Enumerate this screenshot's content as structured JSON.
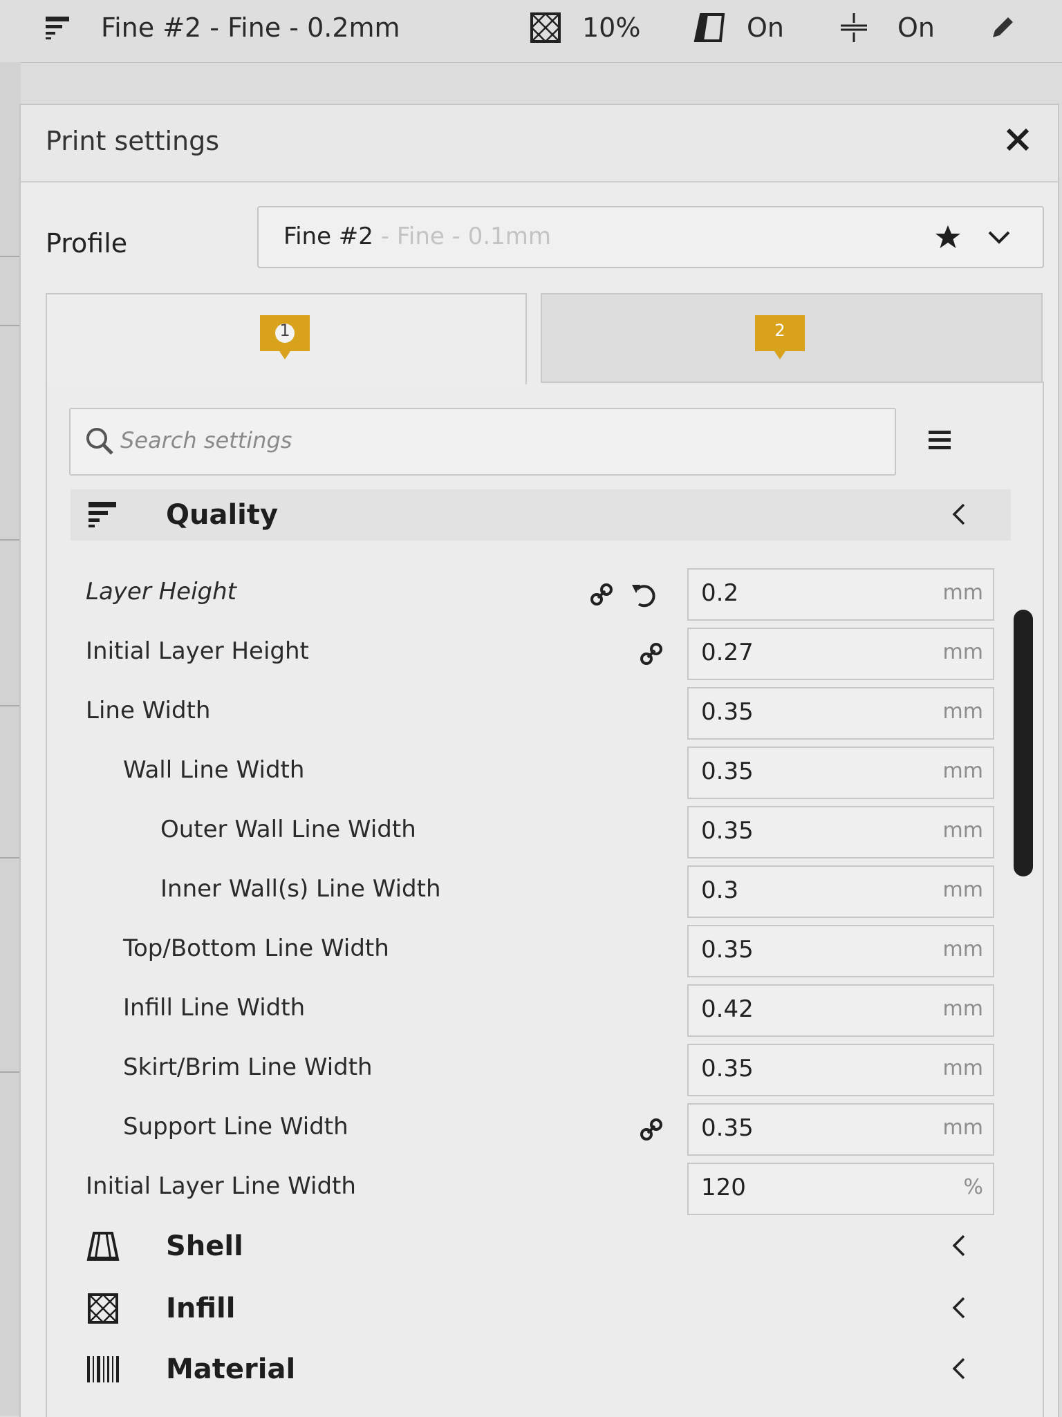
{
  "toolbar": {
    "profile_text": "Fine #2 - Fine - 0.2mm",
    "infill_value": "10%",
    "support_value": "On",
    "adhesion_value": "On"
  },
  "panel": {
    "title": "Print settings",
    "profile_label": "Profile",
    "profile_name": "Fine #2",
    "profile_suffix": " - Fine - 0.1mm",
    "extruder_tabs": [
      "1",
      "2"
    ],
    "search_placeholder": "Search settings"
  },
  "colors": {
    "extruder_badge": "#d9a21c",
    "scrollbar": "#1f1f1f"
  },
  "categories": [
    {
      "label": "Quality",
      "icon": "quality-icon",
      "expanded": true
    },
    {
      "label": "Shell",
      "icon": "shell-icon",
      "expanded": false
    },
    {
      "label": "Infill",
      "icon": "infill-icon",
      "expanded": false
    },
    {
      "label": "Material",
      "icon": "material-icon",
      "expanded": false
    }
  ],
  "settings": [
    {
      "label": "Layer Height",
      "value": "0.2",
      "unit": "mm",
      "linked": true,
      "resettable": true,
      "italic": true
    },
    {
      "label": "Initial Layer Height",
      "value": "0.27",
      "unit": "mm",
      "linked": true
    },
    {
      "label": "Line Width",
      "value": "0.35",
      "unit": "mm"
    },
    {
      "label": "Wall Line Width",
      "value": "0.35",
      "unit": "mm"
    },
    {
      "label": "Outer Wall Line Width",
      "value": "0.35",
      "unit": "mm"
    },
    {
      "label": "Inner Wall(s) Line Width",
      "value": "0.3",
      "unit": "mm"
    },
    {
      "label": "Top/Bottom Line Width",
      "value": "0.35",
      "unit": "mm"
    },
    {
      "label": "Infill Line Width",
      "value": "0.42",
      "unit": "mm"
    },
    {
      "label": "Skirt/Brim Line Width",
      "value": "0.35",
      "unit": "mm"
    },
    {
      "label": "Support Line Width",
      "value": "0.35",
      "unit": "mm",
      "linked": true
    },
    {
      "label": "Initial Layer Line Width",
      "value": "120",
      "unit": "%"
    }
  ]
}
